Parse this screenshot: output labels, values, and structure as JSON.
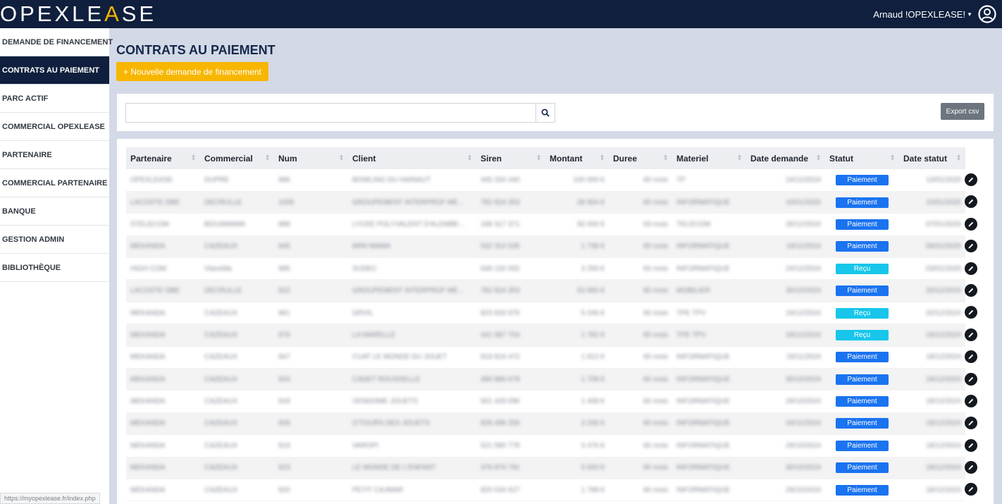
{
  "brand": {
    "logo_part1": "OPEXLE",
    "logo_accent": "A",
    "logo_part2": "SE"
  },
  "user": {
    "name": "Arnaud !OPEXLEASE!"
  },
  "sidebar": {
    "items": [
      {
        "label": "DEMANDE DE FINANCEMENT",
        "active": false
      },
      {
        "label": "CONTRATS AU PAIEMENT",
        "active": true
      },
      {
        "label": "PARC ACTIF",
        "active": false
      },
      {
        "label": "COMMERCIAL OPEXLEASE",
        "active": false
      },
      {
        "label": "PARTENAIRE",
        "active": false
      },
      {
        "label": "COMMERCIAL PARTENAIRE",
        "active": false
      },
      {
        "label": "BANQUE",
        "active": false
      },
      {
        "label": "GESTION ADMIN",
        "active": false
      },
      {
        "label": "BIBLIOTHÈQUE",
        "active": false
      }
    ]
  },
  "status_url": "https://myopexlease.fr/index.php",
  "page": {
    "title": "CONTRATS AU PAIEMENT",
    "new_button": "+ Nouvelle demande de financement",
    "search_value": "",
    "export_button": "Export csv"
  },
  "colors": {
    "paiement": "#1a73f0",
    "recu": "#17c6ea",
    "accent": "#f7b600",
    "navy": "#0f1f3d"
  },
  "table": {
    "columns": [
      "Partenaire",
      "Commercial",
      "Num",
      "Client",
      "Siren",
      "Montant",
      "Duree",
      "Materiel",
      "Date demande",
      "Statut",
      "Date statut"
    ],
    "rows": [
      {
        "partenaire": "OPEXLEASE",
        "commercial": "DUPRE",
        "num": "986",
        "client": "BOWLING DU HAINAUT",
        "siren": "445 334 440",
        "montant": "100 000 €",
        "duree": "60 mois",
        "materiel": "TP",
        "date_demande": "24/12/2024",
        "statut": "Paiement",
        "date_statut": "13/01/2025"
      },
      {
        "partenaire": "LACOSTE DBE",
        "commercial": "DECRULLE",
        "num": "1006",
        "client": "GROUPEMENT INTERPROF ME...",
        "siren": "782 824 353",
        "montant": "28 904 €",
        "duree": "60 mois",
        "materiel": "INFORMATIQUE",
        "date_demande": "10/01/2025",
        "statut": "Paiement",
        "date_statut": "10/01/2025"
      },
      {
        "partenaire": "STELECOM",
        "commercial": "BOUAMAMA",
        "num": "988",
        "client": "LYCEE POLYVALENT D'ALEMBE...",
        "siren": "198 317 371",
        "montant": "93 000 €",
        "duree": "63 mois",
        "materiel": "TELECOM",
        "date_demande": "26/12/2024",
        "statut": "Paiement",
        "date_statut": "07/01/2025"
      },
      {
        "partenaire": "MEKANDA",
        "commercial": "CAZEAUX",
        "num": "945",
        "client": "MINI MAMA",
        "siren": "532 314 535",
        "montant": "1 738 €",
        "duree": "60 mois",
        "materiel": "INFORMATIQUE",
        "date_demande": "19/11/2024",
        "statut": "Paiement",
        "date_statut": "06/01/2025"
      },
      {
        "partenaire": "HIGH COM",
        "commercial": "Vianelda",
        "num": "985",
        "client": "SUDEC",
        "siren": "648 132 932",
        "montant": "3 250 €",
        "duree": "63 mois",
        "materiel": "INFORMATIQUE",
        "date_demande": "24/12/2024",
        "statut": "Reçu",
        "date_statut": "03/01/2025"
      },
      {
        "partenaire": "LACOSTE DBE",
        "commercial": "DECRULLE",
        "num": "822",
        "client": "GROUPEMENT INTERPROF ME...",
        "siren": "782 824 353",
        "montant": "53 965 €",
        "duree": "60 mois",
        "materiel": "MOBILIER",
        "date_demande": "30/10/2024",
        "statut": "Paiement",
        "date_statut": "20/12/2024"
      },
      {
        "partenaire": "MEKANDA",
        "commercial": "CAZEAUX",
        "num": "961",
        "client": "GRVIL",
        "siren": "823 833 975",
        "montant": "5 246 €",
        "duree": "60 mois",
        "materiel": "TPE TPV",
        "date_demande": "19/12/2024",
        "statut": "Reçu",
        "date_statut": "20/12/2024"
      },
      {
        "partenaire": "MEKANDA",
        "commercial": "CAZEAUX",
        "num": "976",
        "client": "LA MARELLE",
        "siren": "441 687 704",
        "montant": "1 782 €",
        "duree": "60 mois",
        "materiel": "TPE TPV",
        "date_demande": "18/12/2024",
        "statut": "Reçu",
        "date_statut": "19/12/2024"
      },
      {
        "partenaire": "MEKANDA",
        "commercial": "CAZEAUX",
        "num": "947",
        "client": "CUAT LE MONDE DU JOUET",
        "siren": "818 816 472",
        "montant": "1 812 €",
        "duree": "60 mois",
        "materiel": "INFORMATIQUE",
        "date_demande": "19/11/2024",
        "statut": "Paiement",
        "date_statut": "18/12/2024"
      },
      {
        "partenaire": "MEKANDA",
        "commercial": "CAZEAUX",
        "num": "924",
        "client": "CADET ROUSSELLE",
        "siren": "490 886 678",
        "montant": "1 708 €",
        "duree": "60 mois",
        "materiel": "INFORMATIQUE",
        "date_demande": "30/10/2024",
        "statut": "Paiement",
        "date_statut": "18/12/2024"
      },
      {
        "partenaire": "MEKANDA",
        "commercial": "CAZEAUX",
        "num": "918",
        "client": "VENDOME JOUETS",
        "siren": "501 429 096",
        "montant": "1 408 €",
        "duree": "60 mois",
        "materiel": "INFORMATIQUE",
        "date_demande": "29/10/2024",
        "statut": "Paiement",
        "date_statut": "18/12/2024"
      },
      {
        "partenaire": "MEKANDA",
        "commercial": "CAZEAUX",
        "num": "928",
        "client": "O'TOURS DES JOUETS",
        "siren": "828 496 256",
        "montant": "3 206 €",
        "duree": "60 mois",
        "materiel": "INFORMATIQUE",
        "date_demande": "04/11/2024",
        "statut": "Paiement",
        "date_statut": "18/12/2024"
      },
      {
        "partenaire": "MEKANDA",
        "commercial": "CAZEAUX",
        "num": "919",
        "client": "VAROPI",
        "siren": "521 580 778",
        "montant": "3 476 €",
        "duree": "60 mois",
        "materiel": "INFORMATIQUE",
        "date_demande": "29/10/2024",
        "statut": "Paiement",
        "date_statut": "18/12/2024"
      },
      {
        "partenaire": "MEKANDA",
        "commercial": "CAZEAUX",
        "num": "923",
        "client": "LE MONDE DE L'ENFANT",
        "siren": "378 876 791",
        "montant": "5 820 €",
        "duree": "60 mois",
        "materiel": "INFORMATIQUE",
        "date_demande": "30/10/2024",
        "statut": "Paiement",
        "date_statut": "18/12/2024"
      },
      {
        "partenaire": "MEKANDA",
        "commercial": "CAZEAUX",
        "num": "920",
        "client": "PETIT CAJMAR",
        "siren": "820 034 627",
        "montant": "1 788 €",
        "duree": "60 mois",
        "materiel": "INFORMATIQUE",
        "date_demande": "29/10/2024",
        "statut": "Paiement",
        "date_statut": "18/12/2024"
      }
    ]
  }
}
